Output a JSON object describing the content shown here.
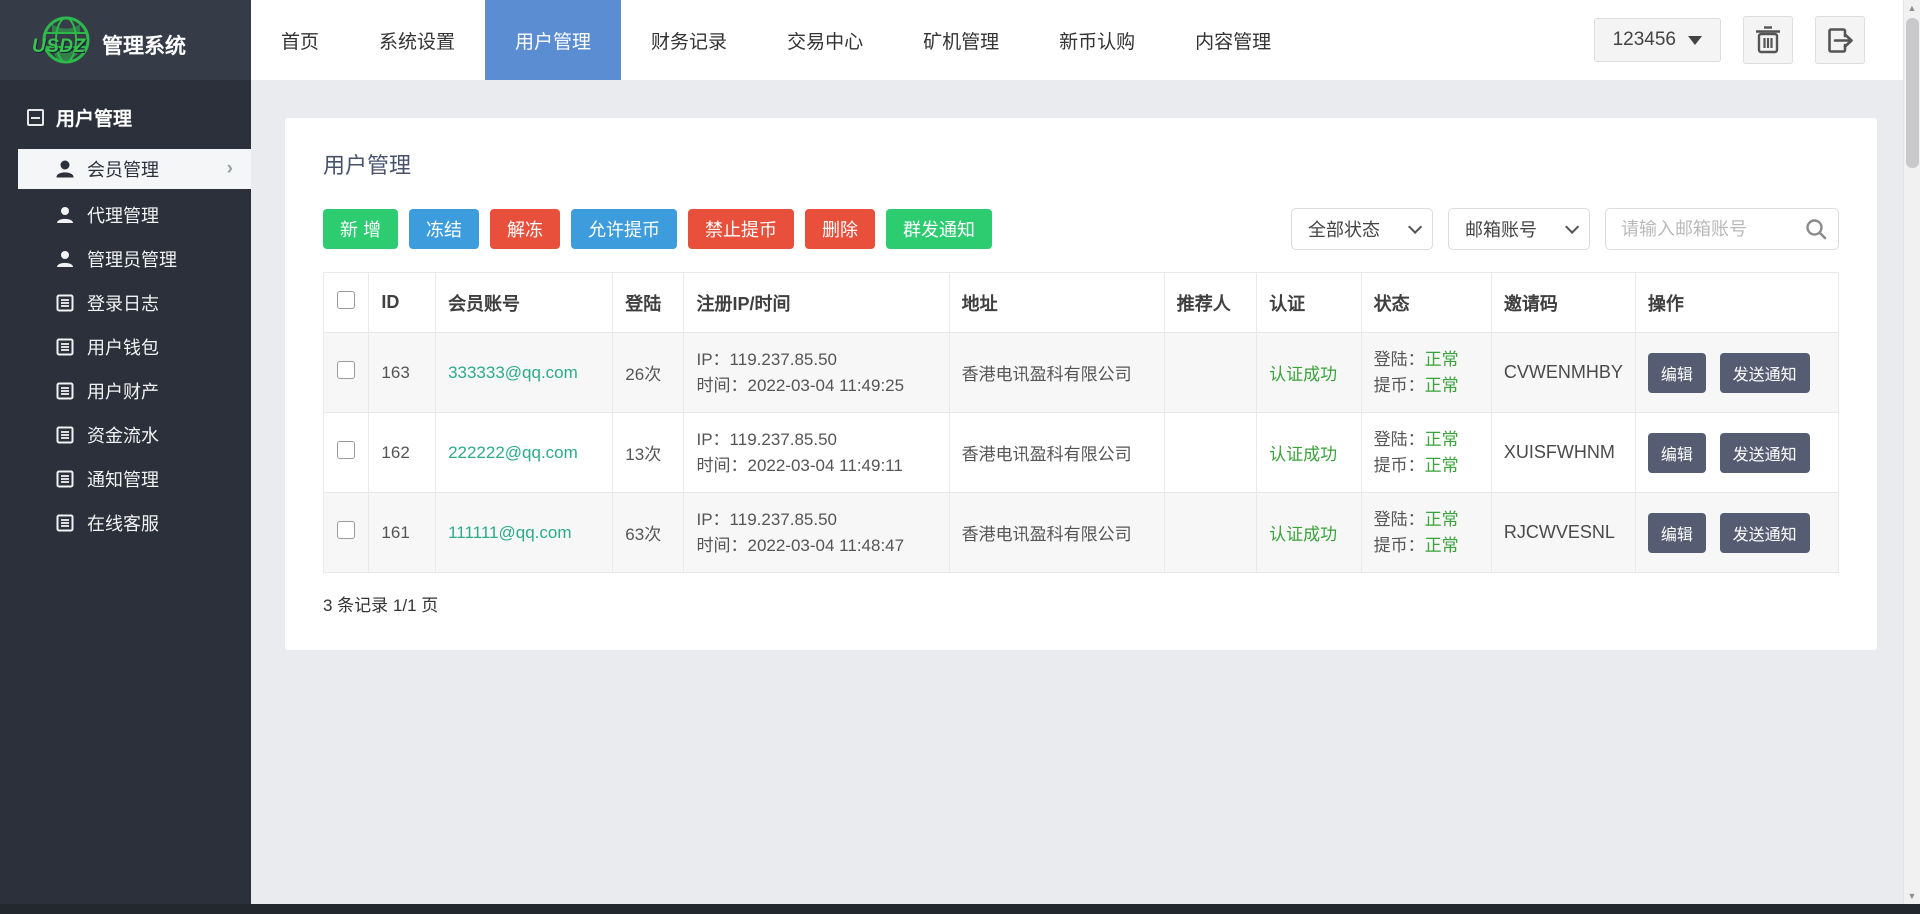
{
  "header": {
    "brand": "USDZ",
    "app_title": "管理系统",
    "nav": [
      {
        "label": "首页",
        "active": false
      },
      {
        "label": "系统设置",
        "active": false
      },
      {
        "label": "用户管理",
        "active": true
      },
      {
        "label": "财务记录",
        "active": false
      },
      {
        "label": "交易中心",
        "active": false
      },
      {
        "label": "矿机管理",
        "active": false
      },
      {
        "label": "新币认购",
        "active": false
      },
      {
        "label": "内容管理",
        "active": false
      }
    ],
    "user_menu_label": "123456"
  },
  "sidebar": {
    "section_title": "用户管理",
    "items": [
      {
        "label": "会员管理",
        "icon": "user-icon",
        "active": true
      },
      {
        "label": "代理管理",
        "icon": "user-icon",
        "active": false
      },
      {
        "label": "管理员管理",
        "icon": "user-icon",
        "active": false
      },
      {
        "label": "登录日志",
        "icon": "list-icon",
        "active": false
      },
      {
        "label": "用户钱包",
        "icon": "list-icon",
        "active": false
      },
      {
        "label": "用户财产",
        "icon": "list-icon",
        "active": false
      },
      {
        "label": "资金流水",
        "icon": "list-icon",
        "active": false
      },
      {
        "label": "通知管理",
        "icon": "list-icon",
        "active": false
      },
      {
        "label": "在线客服",
        "icon": "list-icon",
        "active": false
      }
    ]
  },
  "main": {
    "title": "用户管理",
    "toolbar": [
      {
        "label": "新 增",
        "color": "green"
      },
      {
        "label": "冻结",
        "color": "blue"
      },
      {
        "label": "解冻",
        "color": "red"
      },
      {
        "label": "允许提币",
        "color": "blue"
      },
      {
        "label": "禁止提币",
        "color": "red"
      },
      {
        "label": "删除",
        "color": "red"
      },
      {
        "label": "群发通知",
        "color": "green"
      }
    ],
    "filters": {
      "status_select": "全部状态",
      "field_select": "邮箱账号",
      "search_placeholder": "请输入邮箱账号"
    },
    "table": {
      "headers": [
        "ID",
        "会员账号",
        "登陆",
        "注册IP/时间",
        "地址",
        "推荐人",
        "认证",
        "状态",
        "邀请码",
        "操作"
      ],
      "rows": [
        {
          "id": "163",
          "account": "333333@qq.com",
          "logins": "26次",
          "ip": "IP：119.237.85.50",
          "time": "时间：2022-03-04 11:49:25",
          "address": "香港电讯盈科有限公司",
          "referrer": "",
          "auth": "认证成功",
          "login_label": "登陆：",
          "login_status": "正常",
          "withdraw_label": "提币：",
          "withdraw_status": "正常",
          "invite_code": "CVWENMHBY"
        },
        {
          "id": "162",
          "account": "222222@qq.com",
          "logins": "13次",
          "ip": "IP：119.237.85.50",
          "time": "时间：2022-03-04 11:49:11",
          "address": "香港电讯盈科有限公司",
          "referrer": "",
          "auth": "认证成功",
          "login_label": "登陆：",
          "login_status": "正常",
          "withdraw_label": "提币：",
          "withdraw_status": "正常",
          "invite_code": "XUISFWHNM"
        },
        {
          "id": "161",
          "account": "111111@qq.com",
          "logins": "63次",
          "ip": "IP：119.237.85.50",
          "time": "时间：2022-03-04 11:48:47",
          "address": "香港电讯盈科有限公司",
          "referrer": "",
          "auth": "认证成功",
          "login_label": "登陆：",
          "login_status": "正常",
          "withdraw_label": "提币：",
          "withdraw_status": "正常",
          "invite_code": "RJCWVESNL"
        }
      ],
      "row_actions": {
        "edit": "编辑",
        "notify": "发送通知"
      }
    },
    "pagination": "3 条记录 1/1 页"
  },
  "colors": {
    "active_tab_blue": "#5b8dd3",
    "sidebar_dark": "#2b303b",
    "header_logo_dark": "#363b48",
    "button_green": "#2ecc71",
    "button_blue": "#3d9cdb",
    "button_red": "#e8503c",
    "email_link_teal": "#2cab8b",
    "status_green": "#3aa33a",
    "row_action_slate": "#565d72"
  }
}
